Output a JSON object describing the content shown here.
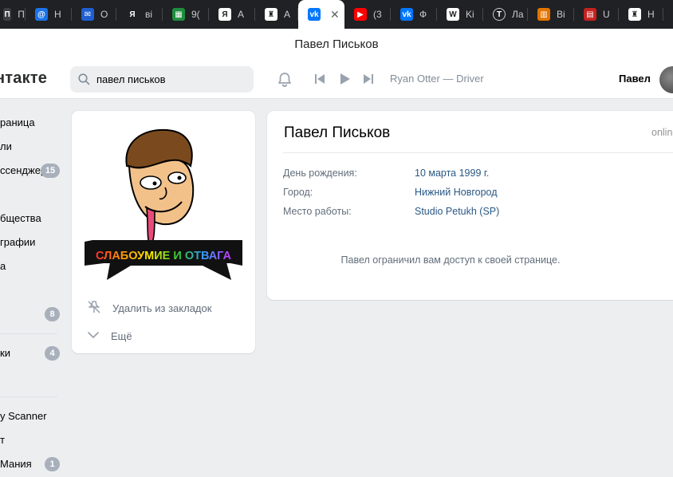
{
  "browser": {
    "tabs": [
      {
        "title": "Пи",
        "icon": "tab-icon-generic",
        "color": "#3c4043",
        "glyph": "П"
      },
      {
        "title": "Н",
        "icon": "mail-ru-icon",
        "color": "#1a73e8",
        "glyph": "@"
      },
      {
        "title": "О",
        "icon": "mail-envelope-icon",
        "color": "#1f5fd1",
        "glyph": "✉"
      },
      {
        "title": "ві",
        "icon": "yandex-icon",
        "color": "#202124",
        "glyph": "Я"
      },
      {
        "title": "9(",
        "icon": "sheets-icon",
        "color": "#1e8e3e",
        "glyph": "▦"
      },
      {
        "title": "A",
        "icon": "yandex-browser-icon",
        "color": "#ffffff",
        "glyph": "Я"
      },
      {
        "title": "A",
        "icon": "chess-icon",
        "color": "#ffffff",
        "glyph": "♜"
      },
      {
        "title": "Павел Письков",
        "icon": "vk-icon",
        "color": "#0077ff",
        "glyph": "vk"
      },
      {
        "title": "(3",
        "icon": "youtube-icon",
        "color": "#ff0000",
        "glyph": "▶"
      },
      {
        "title": "Ф",
        "icon": "vk-icon",
        "color": "#0077ff",
        "glyph": "vk"
      },
      {
        "title": "Ki",
        "icon": "wikipedia-icon",
        "color": "#ffffff",
        "glyph": "W"
      },
      {
        "title": "Ла",
        "icon": "t-circle-icon",
        "color": "#202124",
        "glyph": "T"
      },
      {
        "title": "Ві",
        "icon": "library-icon",
        "color": "#e37400",
        "glyph": "▥"
      },
      {
        "title": "U",
        "icon": "bars-icon",
        "color": "#c5221f",
        "glyph": "▤"
      },
      {
        "title": "Н",
        "icon": "chess-icon",
        "color": "#ffffff",
        "glyph": "♜"
      },
      {
        "title": "",
        "icon": "tab-icon-orange",
        "color": "#f29900",
        "glyph": ""
      }
    ],
    "active_tab_index": 7,
    "window_title": "Павел Письков"
  },
  "header": {
    "logo": "нтакте",
    "search_value": "павел письков",
    "track": "Ryan Otter — Driver",
    "user_name": "Павел"
  },
  "left_menu": {
    "items": [
      {
        "label": "раница",
        "badge": ""
      },
      {
        "label": "ли",
        "badge": ""
      },
      {
        "label": "ссенджер",
        "badge": "15"
      },
      {
        "label": "",
        "badge": ""
      },
      {
        "label": "бщества",
        "badge": ""
      },
      {
        "label": "графии",
        "badge": ""
      },
      {
        "label": "а",
        "badge": ""
      },
      {
        "label": "",
        "badge": ""
      },
      {
        "label": "",
        "badge": "8"
      },
      {
        "label": "ки",
        "badge": "4"
      },
      {
        "label": "y Scanner",
        "badge": ""
      },
      {
        "label": "т",
        "badge": ""
      },
      {
        "label": "Мания",
        "badge": "1"
      }
    ]
  },
  "profile": {
    "name": "Павел Письков",
    "status": "online",
    "fields": [
      {
        "key": "День рождения:",
        "value": "10 марта 1999 г."
      },
      {
        "key": "Город:",
        "value": "Нижний Новгород"
      },
      {
        "key": "Место работы:",
        "value": "Studio Petukh (SP)"
      }
    ],
    "restricted_text": "Павел ограничил вам доступ к своей странице.",
    "photo_banner": "СЛАБОУМИЕ И ОТВАГА",
    "actions": {
      "remove_bookmark": "Удалить из закладок",
      "more": "Ещё"
    }
  },
  "colors": {
    "vk_blue": "#0077ff",
    "link": "#2a5885",
    "page_bg": "#edeef0",
    "tabstrip": "#202124"
  }
}
